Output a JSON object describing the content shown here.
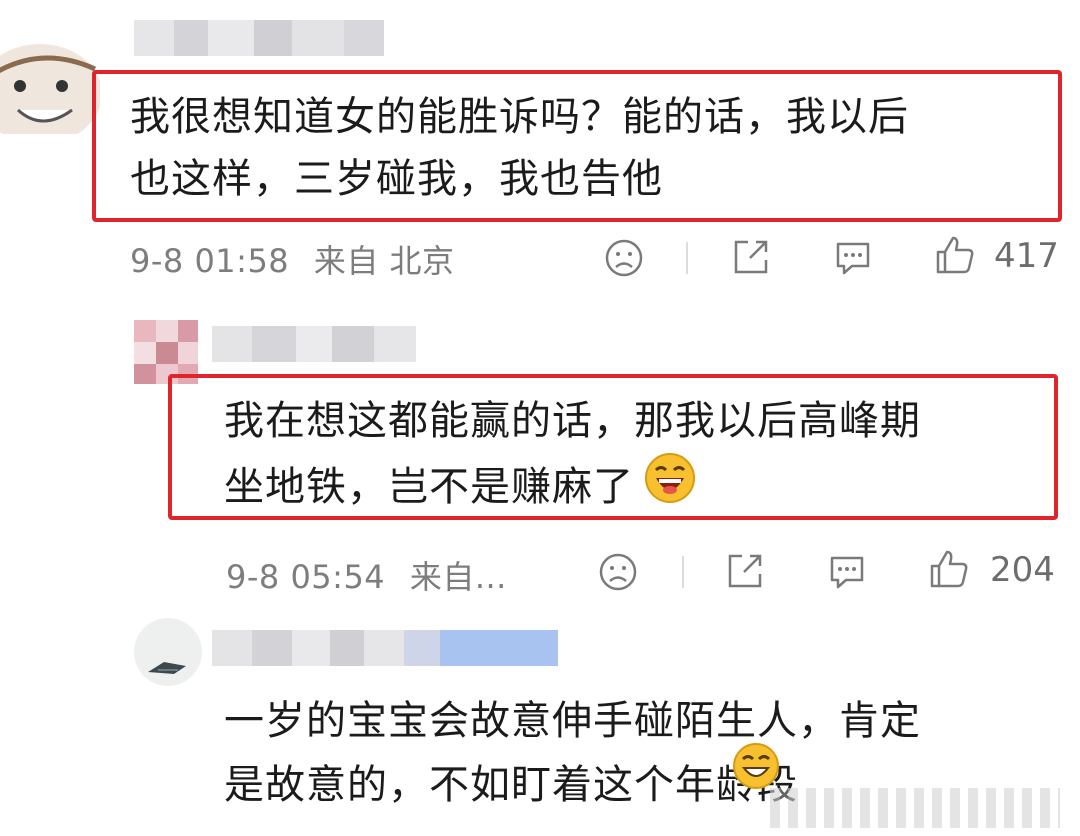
{
  "comments": [
    {
      "text_line1": "我很想知道女的能胜诉吗？能的话，我以后",
      "text_line2": "也这样，三岁碰我，我也告他",
      "time": "9-8 01:58",
      "location": "来自 北京",
      "likes": "417",
      "icons": [
        "sad-face-icon",
        "share-icon",
        "comment-icon",
        "thumbs-up-icon"
      ]
    },
    {
      "text_line1": "我在想这都能赢的话，那我以后高峰期",
      "text_line2": "坐地铁，岂不是赚麻了",
      "emoji": "laughing-emoji-icon",
      "time": "9-8 05:54",
      "location": "来自...",
      "likes": "204",
      "icons": [
        "sad-face-icon",
        "share-icon",
        "comment-icon",
        "thumbs-up-icon"
      ]
    },
    {
      "text_line1": "一岁的宝宝会故意伸手碰陌生人，肯定",
      "text_line2": "是故意的，不如盯着这个年龄段",
      "emoji": "grin-emoji-icon"
    }
  ],
  "colors": {
    "highlight": "#e0242b",
    "meta": "#7d7d7d"
  }
}
